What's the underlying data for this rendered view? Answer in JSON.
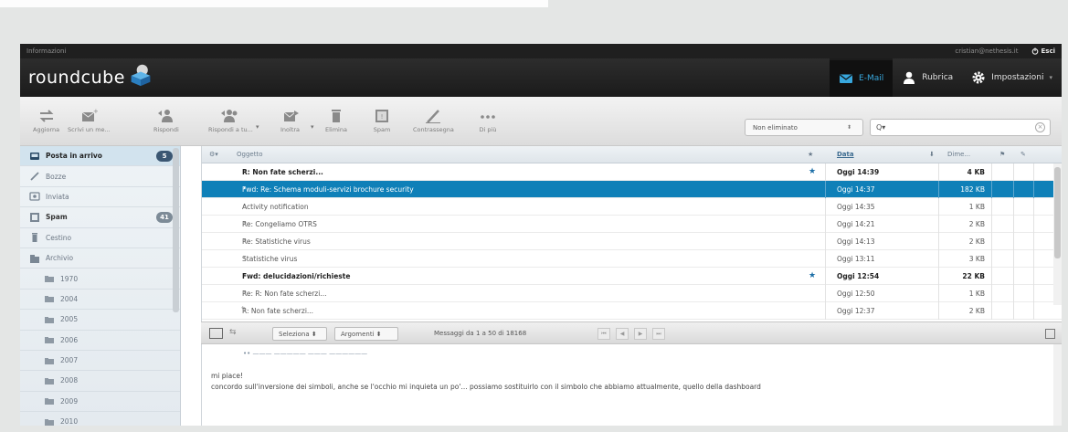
{
  "topbar": {
    "info": "Informazioni",
    "user": "cristian@nethesis.it",
    "logout": "Esci"
  },
  "header": {
    "logo": "roundcube"
  },
  "nav": [
    {
      "label": "E-Mail",
      "icon": "mail-icon",
      "active": true
    },
    {
      "label": "Rubrica",
      "icon": "contacts-icon",
      "active": false
    },
    {
      "label": "Impostazioni",
      "icon": "gear-icon",
      "active": false
    }
  ],
  "toolbar": {
    "refresh": "Aggiorna",
    "compose": "Scrivi un me...",
    "reply": "Rispondi",
    "reply_all": "Rispondi a tu...",
    "forward": "Inoltra",
    "delete": "Elimina",
    "spam": "Spam",
    "mark": "Contrassegna",
    "more": "Di più",
    "filter": "Non eliminato",
    "search_placeholder": "Q▾"
  },
  "folders": [
    {
      "name": "Posta in arrivo",
      "icon": "inbox-icon",
      "badge": "5",
      "active": true
    },
    {
      "name": "Bozze",
      "icon": "drafts-icon"
    },
    {
      "name": "Inviata",
      "icon": "sent-icon"
    },
    {
      "name": "Spam",
      "icon": "spam-icon",
      "badge": "41",
      "bold": true
    },
    {
      "name": "Cestino",
      "icon": "trash-icon"
    },
    {
      "name": "Archivio",
      "icon": "archive-icon"
    },
    {
      "name": "1970",
      "icon": "folder-icon",
      "sub": true
    },
    {
      "name": "2004",
      "icon": "folder-icon",
      "sub": true
    },
    {
      "name": "2005",
      "icon": "folder-icon",
      "sub": true
    },
    {
      "name": "2006",
      "icon": "folder-icon",
      "sub": true
    },
    {
      "name": "2007",
      "icon": "folder-icon",
      "sub": true
    },
    {
      "name": "2008",
      "icon": "folder-icon",
      "sub": true
    },
    {
      "name": "2009",
      "icon": "folder-icon",
      "sub": true
    },
    {
      "name": "2010",
      "icon": "folder-icon",
      "sub": true
    }
  ],
  "list": {
    "columns": {
      "subject": "Oggetto",
      "date": "Data",
      "size": "Dime..."
    },
    "rows": [
      {
        "subject": "R: Non fate scherzi...",
        "date": "Oggi 14:39",
        "size": "4 KB",
        "unread": true,
        "flagged": true
      },
      {
        "subject": "Fwd: Re: Schema moduli-servizi brochure security",
        "date": "Oggi 14:37",
        "size": "182 KB",
        "selected": true
      },
      {
        "subject": "Activity notification",
        "date": "Oggi 14:35",
        "size": "1 KB"
      },
      {
        "subject": "Re: Congeliamo OTRS",
        "date": "Oggi 14:21",
        "size": "2 KB"
      },
      {
        "subject": "Re: Statistiche virus",
        "date": "Oggi 14:13",
        "size": "2 KB"
      },
      {
        "subject": "Statistiche virus",
        "date": "Oggi 13:11",
        "size": "3 KB"
      },
      {
        "subject": "Fwd: delucidazioni/richieste",
        "date": "Oggi 12:54",
        "size": "22 KB",
        "unread": true,
        "flagged": true
      },
      {
        "subject": "Re: R: Non fate scherzi...",
        "date": "Oggi 12:50",
        "size": "1 KB"
      },
      {
        "subject": "R: Non fate scherzi...",
        "date": "Oggi 12:37",
        "size": "2 KB",
        "replied": true
      }
    ]
  },
  "list_footer": {
    "select": "Seleziona",
    "threads": "Argomenti",
    "count": "Messaggi da 1 a 50 di 18168"
  },
  "preview": {
    "line1": "mi piace!",
    "line2": "concordo sull'inversione dei simboli, anche se l'occhio mi inquieta un po'... possiamo sostituirlo con il simbolo che abbiamo attualmente, quello della dashboard"
  }
}
